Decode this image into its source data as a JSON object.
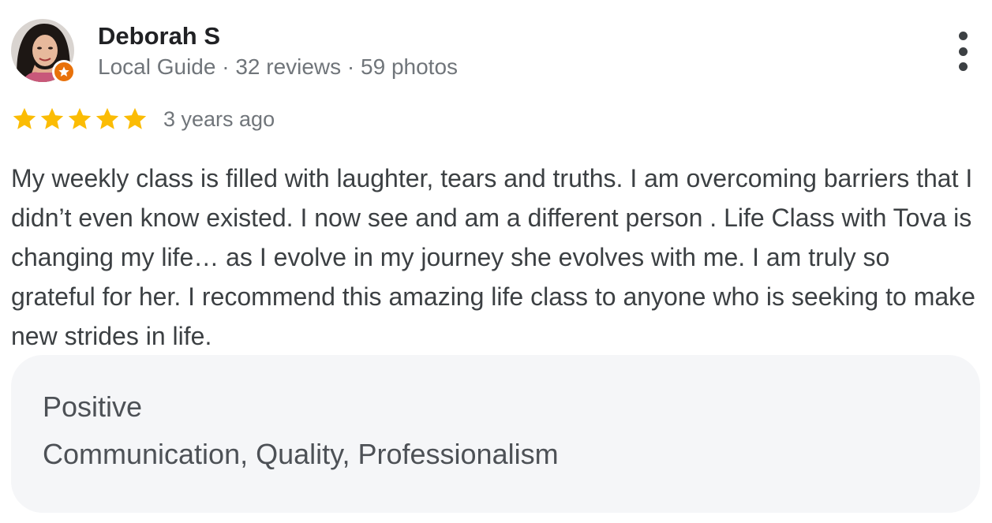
{
  "reviewer": {
    "name": "Deborah S",
    "meta": "Local Guide · 32 reviews · 59 photos",
    "avatar": "profile-photo",
    "badge": "local-guide-star-icon"
  },
  "menu": {
    "icon": "more-vert-icon"
  },
  "rating": {
    "stars": 5,
    "max": 5,
    "star_color": "#fbbc04",
    "date": "3 years ago"
  },
  "review": {
    "text": "My weekly class is filled with laughter, tears and truths. I am overcoming barriers that I didn’t even know existed. I now see and am a different person . Life Class with Tova is changing my life… as I evolve in my journey she evolves with me. I am truly so grateful for her. I recommend this amazing life class to anyone who is seeking to make new strides in life."
  },
  "attributes": {
    "heading": "Positive",
    "values": "Communication, Quality, Professionalism"
  },
  "colors": {
    "badge": "#e8710a",
    "panel": "#f5f6f8",
    "text": "#3c4043",
    "meta": "#70757a"
  }
}
